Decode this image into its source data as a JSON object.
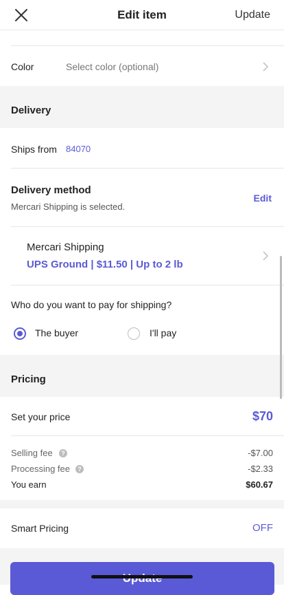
{
  "header": {
    "title": "Edit item",
    "update_label": "Update"
  },
  "color": {
    "label": "Color",
    "value": "Select color (optional)"
  },
  "delivery": {
    "section_title": "Delivery",
    "ships_from_label": "Ships from",
    "ships_from_value": "84070",
    "method_label": "Delivery method",
    "method_subtitle": "Mercari Shipping is selected.",
    "edit_label": "Edit",
    "carrier_title": "Mercari Shipping",
    "carrier_detail": "UPS Ground | $11.50 | Up to 2 lb",
    "payer_question": "Who do you want to pay for shipping?",
    "options": [
      {
        "label": "The buyer",
        "selected": true
      },
      {
        "label": "I'll pay",
        "selected": false
      }
    ]
  },
  "pricing": {
    "section_title": "Pricing",
    "set_price_label": "Set your price",
    "price_value": "$70",
    "selling_fee_label": "Selling fee",
    "selling_fee_value": "-$7.00",
    "processing_fee_label": "Processing fee",
    "processing_fee_value": "-$2.33",
    "you_earn_label": "You earn",
    "you_earn_value": "$60.67"
  },
  "smart_pricing": {
    "label": "Smart Pricing",
    "value": "OFF"
  },
  "cta": {
    "label": "Update"
  },
  "colors": {
    "accent": "#5a5ad6",
    "band": "#f4f4f4"
  },
  "icons": {
    "close": "close-icon",
    "chevron": "chevron-right-icon",
    "help": "help-icon"
  }
}
